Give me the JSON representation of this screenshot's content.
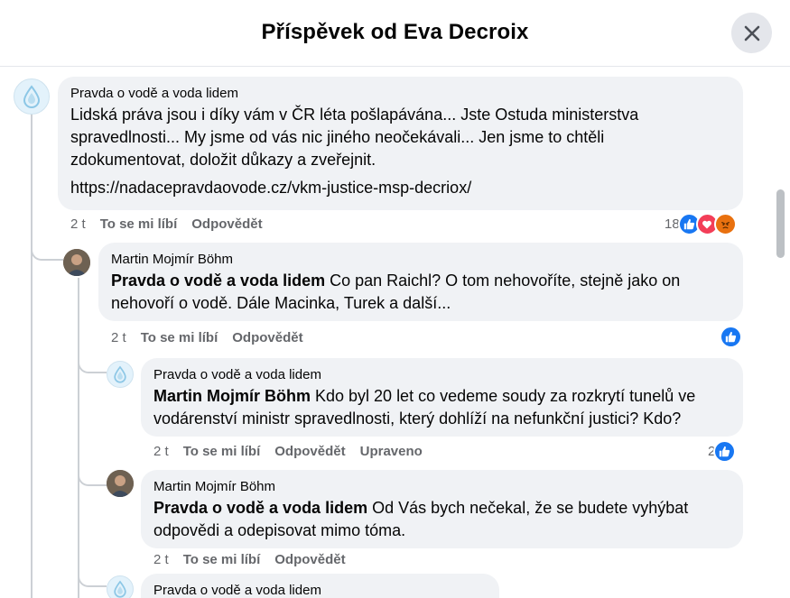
{
  "header": {
    "title": "Příspěvek od Eva Decroix"
  },
  "comments": [
    {
      "author": "Pravda o vodě a voda lidem",
      "text": "Lidská práva jsou i díky vám v ČR léta pošlapávána... Jste Ostuda ministerstva spravedlnosti... My jsme od vás nic jiného neočekávali... Jen jsme to chtěli zdokumentovat, doložit důkazy a zveřejnit.",
      "link": "https://nadacepravdaovode.cz/vkm-justice-msp-decriox/",
      "time": "2 t",
      "like": "To se mi líbí",
      "reply": "Odpovědět",
      "reaction_count": "18"
    },
    {
      "author": "Martin Mojmír Böhm",
      "mention": "Pravda o vodě a voda lidem",
      "text": " Co pan Raichl? O tom nehovoříte, stejně jako on nehovoří o vodě. Dále Macinka, Turek a další...",
      "time": "2 t",
      "like": "To se mi líbí",
      "reply": "Odpovědět"
    },
    {
      "author": "Pravda o vodě a voda lidem",
      "mention": "Martin Mojmír Böhm",
      "text": " Kdo byl 20 let co vedeme soudy za rozkrytí tunelů ve vodárenství ministr spravedlnosti, který dohlíží na nefunkční justici? Kdo?",
      "time": "2 t",
      "like": "To se mi líbí",
      "reply": "Odpovědět",
      "edited": "Upraveno",
      "reaction_count": "2"
    },
    {
      "author": "Martin Mojmír Böhm",
      "mention": "Pravda o vodě a voda lidem",
      "text": " Od Vás bych nečekal, že se budete vyhýbat odpovědi a odepisovat mimo tóma.",
      "time": "2 t",
      "like": "To se mi líbí",
      "reply": "Odpovědět"
    },
    {
      "author": "Pravda o vodě a voda lidem"
    }
  ],
  "colors": {
    "accent_blue": "#1877f2",
    "love_red": "#f33e58",
    "angry_orange": "#e9710f",
    "bubble_bg": "#f0f2f5",
    "meta_gray": "#65676b"
  },
  "icons": {
    "close": "close-icon",
    "page_avatar": "water-drop-icon",
    "like": "like-icon",
    "love": "love-icon",
    "angry": "angry-icon"
  }
}
